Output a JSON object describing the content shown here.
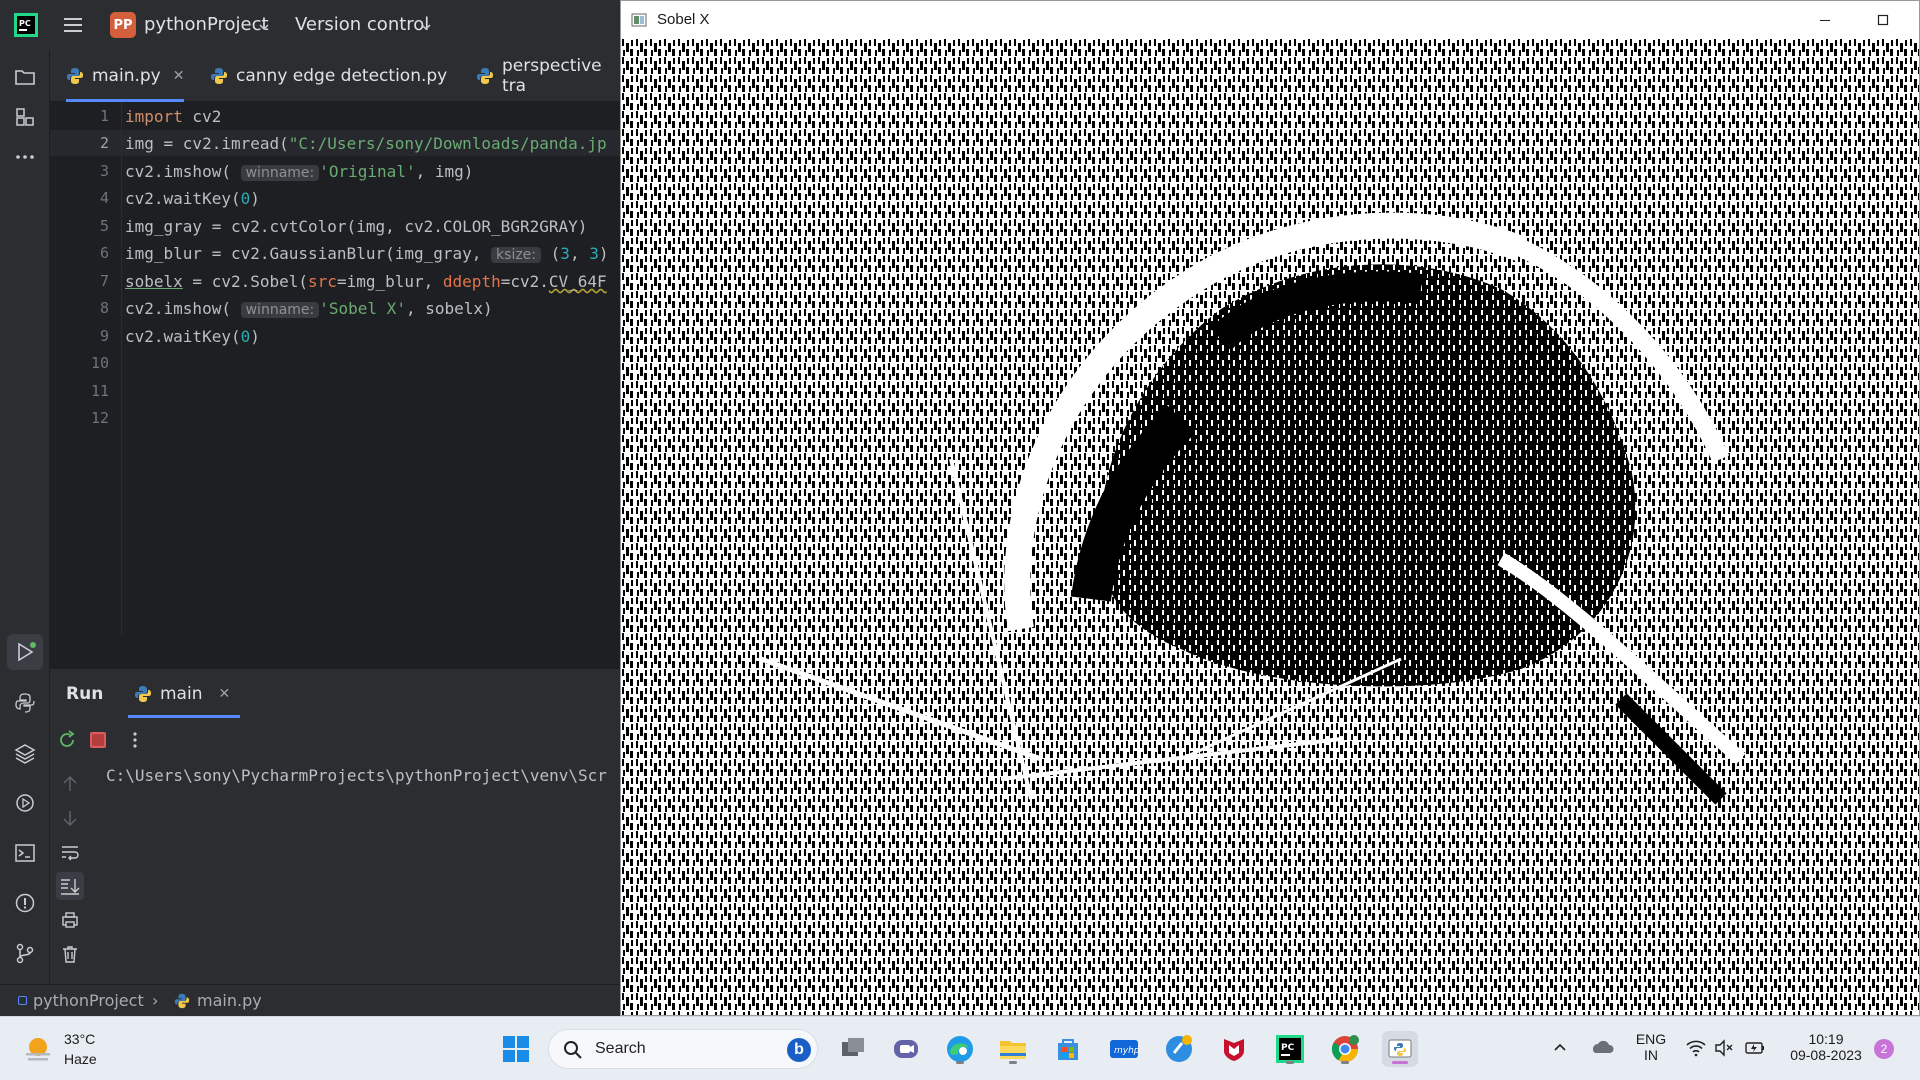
{
  "ide": {
    "project_chip": "PP",
    "project_name": "pythonProject",
    "version_control": "Version control",
    "tabs": [
      {
        "label": "main.py"
      },
      {
        "label": "canny edge detection.py"
      },
      {
        "label": "perspective tra"
      }
    ],
    "line_numbers": [
      "1",
      "2",
      "3",
      "4",
      "5",
      "6",
      "7",
      "8",
      "9",
      "10",
      "11",
      "12"
    ],
    "current_line": 2,
    "code": {
      "l1_kw": "import",
      "l1_rest": " cv2",
      "l2_pre": "img = cv2.imread(",
      "l2_str": "\"C:/Users/sony/Downloads/panda.jp",
      "l3_pre": "cv2.imshow(",
      "l3_hint": "winname:",
      "l3_str": "'Original'",
      "l3_post": ", img)",
      "l4_pre": "cv2.waitKey(",
      "l4_num": "0",
      "l4_post": ")",
      "l5": "img_gray = cv2.cvtColor(img, cv2.COLOR_BGR2GRAY)",
      "l6_pre": "img_blur = cv2.GaussianBlur(img_gray, ",
      "l6_hint": "ksize:",
      "l6_post1": " (",
      "l6_num1": "3",
      "l6_post2": ", ",
      "l6_num2": "3",
      "l6_post3": ")",
      "l7_var": "sobelx",
      "l7_mid": " = cv2.Sobel(",
      "l7_p1": "src",
      "l7_mid2": "=img_blur, ",
      "l7_p2": "ddepth",
      "l7_mid3": "=cv2.",
      "l7_end": "CV_64F",
      "l8_pre": "cv2.imshow(",
      "l8_hint": "winname:",
      "l8_str": "'Sobel X'",
      "l8_post": ", sobelx)",
      "l9_pre": "cv2.waitKey(",
      "l9_num": "0",
      "l9_post": ")"
    },
    "run": {
      "title": "Run",
      "tab": "main",
      "console_line": "C:\\Users\\sony\\PycharmProjects\\pythonProject\\venv\\Scr"
    },
    "statusbar": {
      "project": "pythonProject",
      "file": "main.py"
    }
  },
  "image_window": {
    "title": "Sobel X"
  },
  "taskbar": {
    "weather_temp": "33°C",
    "weather_desc": "Haze",
    "search_label": "Search",
    "lang_top": "ENG",
    "lang_bottom": "IN",
    "time": "10:19",
    "date": "09-08-2023",
    "notification_count": "2"
  },
  "colors": {
    "accent": "#548af7",
    "run_stop": "#db5c5c",
    "run_green": "#5fb865"
  }
}
